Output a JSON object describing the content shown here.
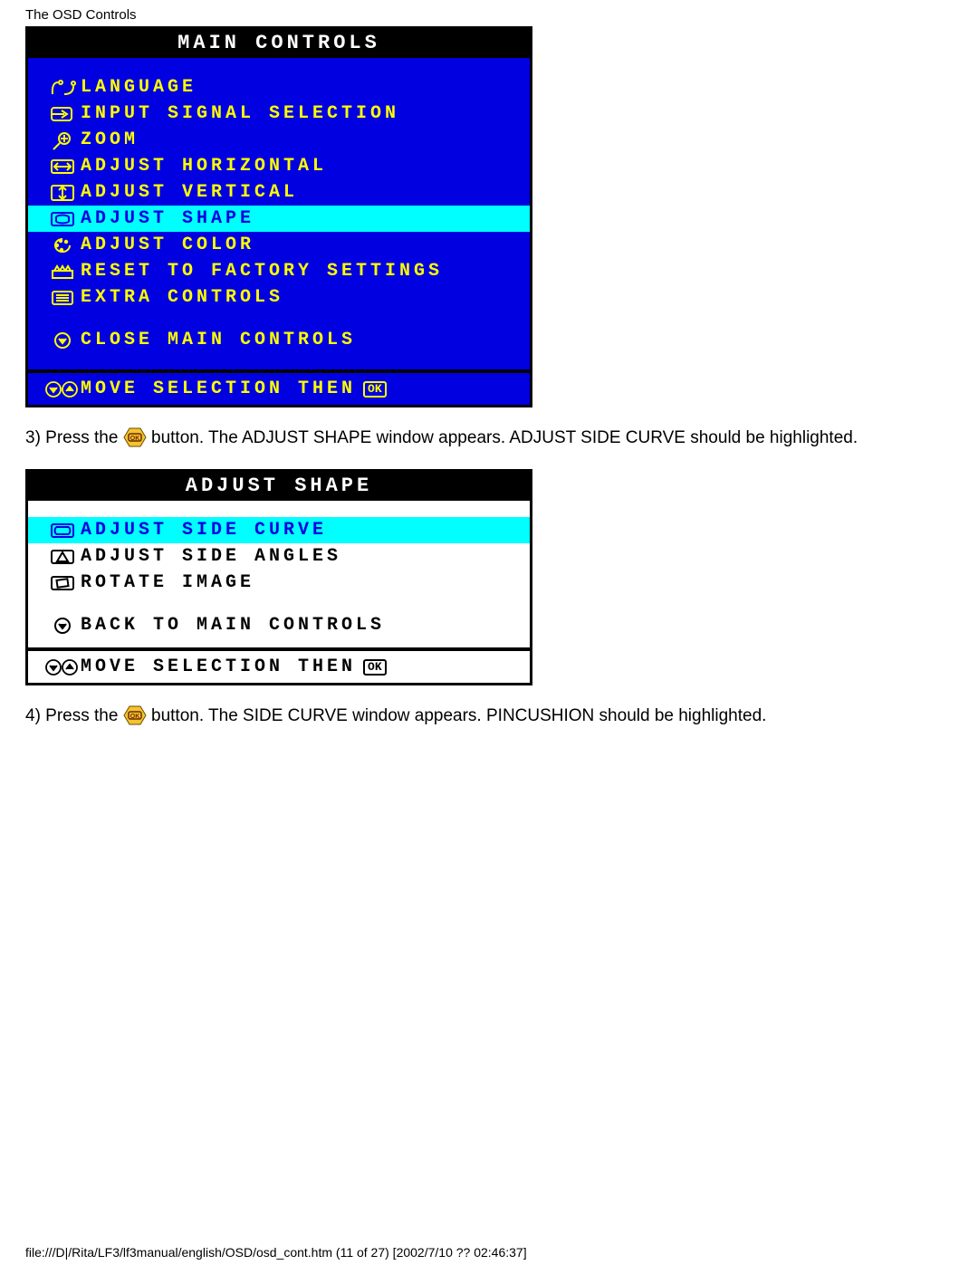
{
  "page_header": "The OSD Controls",
  "main_menu": {
    "title": "MAIN CONTROLS",
    "items": [
      {
        "label": "LANGUAGE"
      },
      {
        "label": "INPUT SIGNAL SELECTION"
      },
      {
        "label": "ZOOM"
      },
      {
        "label": "ADJUST HORIZONTAL"
      },
      {
        "label": "ADJUST VERTICAL"
      },
      {
        "label": "ADJUST SHAPE",
        "highlighted": true
      },
      {
        "label": "ADJUST COLOR"
      },
      {
        "label": "RESET TO FACTORY SETTINGS"
      },
      {
        "label": "EXTRA CONTROLS"
      }
    ],
    "close_label": "CLOSE MAIN CONTROLS",
    "footer_text": "MOVE SELECTION THEN",
    "footer_ok": "OK"
  },
  "instruction_3a": "3) Press the ",
  "instruction_3b": " button. The ADJUST SHAPE window appears. ADJUST SIDE CURVE should be highlighted.",
  "shape_menu": {
    "title": "ADJUST SHAPE",
    "items": [
      {
        "label": "ADJUST SIDE CURVE",
        "highlighted": true
      },
      {
        "label": "ADJUST SIDE ANGLES"
      },
      {
        "label": "ROTATE IMAGE"
      }
    ],
    "back_label": "BACK TO MAIN CONTROLS",
    "footer_text": "MOVE SELECTION THEN",
    "footer_ok": "OK"
  },
  "instruction_4a": "4) Press the ",
  "instruction_4b": " button. The SIDE CURVE window appears. PINCUSHION should be highlighted.",
  "footer_path": "file:///D|/Rita/LF3/lf3manual/english/OSD/osd_cont.htm (11 of 27) [2002/7/10 ?? 02:46:37]"
}
